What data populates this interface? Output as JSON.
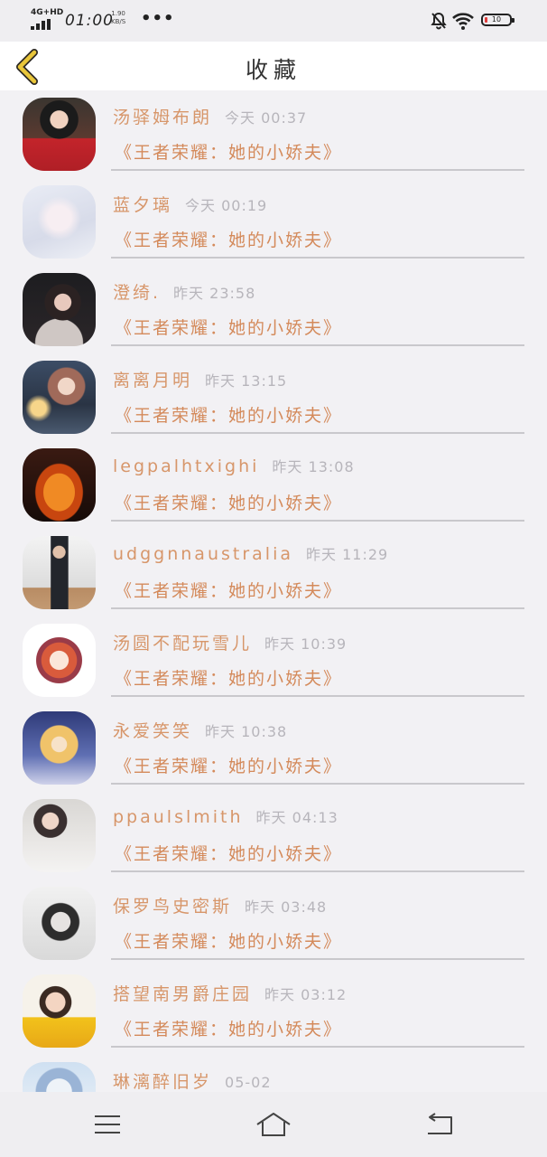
{
  "status_bar": {
    "network": "4G+HD",
    "time": "01:00",
    "speed_value": "1.90",
    "speed_unit": "KB/S",
    "more": "•••",
    "battery": "10",
    "battery_fraction": 0.1,
    "icons": [
      "mute-icon",
      "wifi-icon",
      "battery-icon"
    ]
  },
  "header": {
    "title": "收藏",
    "back_icon": "chevron-left-icon"
  },
  "items": [
    {
      "name": "汤驿姆布朗",
      "time": "今天 00:37",
      "book": "《王者荣耀：她的小娇夫》"
    },
    {
      "name": "蓝夕璃",
      "time": "今天 00:19",
      "book": "《王者荣耀：她的小娇夫》"
    },
    {
      "name": "澄绮.",
      "time": "昨天 23:58",
      "book": "《王者荣耀：她的小娇夫》"
    },
    {
      "name": "离离月明",
      "time": "昨天 13:15",
      "book": "《王者荣耀：她的小娇夫》"
    },
    {
      "name": "legpalhtxighi",
      "time": "昨天 13:08",
      "book": "《王者荣耀：她的小娇夫》"
    },
    {
      "name": "udggnnaustralia",
      "time": "昨天 11:29",
      "book": "《王者荣耀：她的小娇夫》"
    },
    {
      "name": "汤圆不配玩雪儿",
      "time": "昨天 10:39",
      "book": "《王者荣耀：她的小娇夫》"
    },
    {
      "name": "永爱笑笑",
      "time": "昨天 10:38",
      "book": "《王者荣耀：她的小娇夫》"
    },
    {
      "name": "ppaulslmith",
      "time": "昨天 04:13",
      "book": "《王者荣耀：她的小娇夫》"
    },
    {
      "name": "保罗鸟史密斯",
      "time": "昨天 03:48",
      "book": "《王者荣耀：她的小娇夫》"
    },
    {
      "name": "搭望南男爵庄园",
      "time": "昨天 03:12",
      "book": "《王者荣耀：她的小娇夫》"
    },
    {
      "name": "琳漓醉旧岁",
      "time": "05-02",
      "book": ""
    }
  ],
  "nav_bar": {
    "icons": [
      "menu-icon",
      "home-icon",
      "back-arrow-icon"
    ]
  },
  "colors": {
    "name": "#d7966a",
    "book": "#d48a5b",
    "time": "#b7b5bb",
    "back_chevron": "#e9c63a",
    "battery_low": "#e23b3b"
  }
}
